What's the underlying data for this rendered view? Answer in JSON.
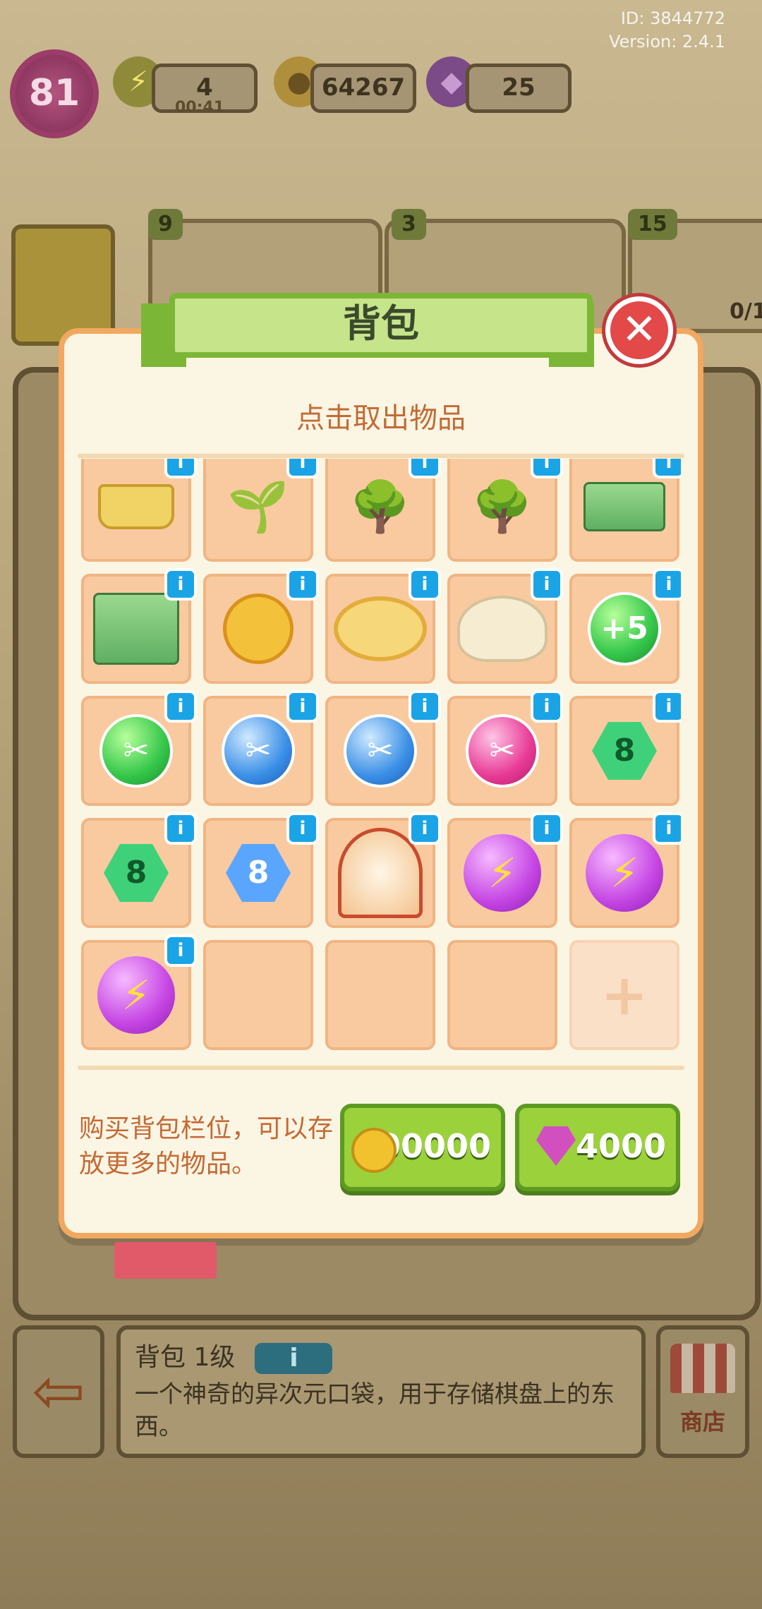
{
  "header": {
    "id_text": "ID: 3844772",
    "version_text": "Version: 2.4.1",
    "level": "81",
    "energy": "4",
    "energy_timer": "00:41",
    "coins": "64267",
    "gems": "25"
  },
  "background": {
    "star_badges": [
      "9",
      "3",
      "15"
    ],
    "trophy_text": "0/1"
  },
  "modal": {
    "title": "背包",
    "subtitle": "点击取出物品",
    "close_icon": "close-icon",
    "items": [
      {
        "kind": "basket",
        "name": "basket-item"
      },
      {
        "kind": "sprout",
        "name": "sprout-pot-item"
      },
      {
        "kind": "tree",
        "name": "flower-tree-item"
      },
      {
        "kind": "tree",
        "name": "flower-tree-item"
      },
      {
        "kind": "cash",
        "name": "cash-bundle-item"
      },
      {
        "kind": "cash-big",
        "name": "cash-pile-item"
      },
      {
        "kind": "medal",
        "name": "medal-item"
      },
      {
        "kind": "ring",
        "name": "duck-float-item"
      },
      {
        "kind": "duck",
        "name": "duck-plush-item"
      },
      {
        "kind": "orb-green",
        "name": "plus5-orb-item",
        "label": "+5"
      },
      {
        "kind": "orb-green",
        "name": "scissors-green-orb-item",
        "label": "✂"
      },
      {
        "kind": "orb-blue",
        "name": "scissors-blue-orb-item",
        "label": "✂"
      },
      {
        "kind": "orb-blue",
        "name": "scissors-blue-orb-item",
        "label": "✂"
      },
      {
        "kind": "orb-pink",
        "name": "scissors-pink-orb-item",
        "label": "✂"
      },
      {
        "kind": "hex-green",
        "name": "hourglass-green-item",
        "label": "8"
      },
      {
        "kind": "hex-green",
        "name": "hourglass-green-item",
        "label": "8"
      },
      {
        "kind": "hex-blue",
        "name": "hourglass-blue-item",
        "label": "8"
      },
      {
        "kind": "globe",
        "name": "plasma-globe-item"
      },
      {
        "kind": "orb-purple",
        "name": "energy-orb-item",
        "label": "⚡"
      },
      {
        "kind": "orb-purple",
        "name": "energy-orb-item",
        "label": "⚡"
      },
      {
        "kind": "orb-purple",
        "name": "energy-orb-item",
        "label": "⚡"
      },
      {
        "kind": "empty"
      },
      {
        "kind": "empty"
      },
      {
        "kind": "empty"
      },
      {
        "kind": "add"
      }
    ],
    "buy_text": "购买背包栏位，可以存放更多的物品。",
    "buy_coins_label": "100000",
    "buy_gems_label": "4000"
  },
  "bottom": {
    "item_title": "背包 1级",
    "item_desc": "一个神奇的异次元口袋，用于存储棋盘上的东西。",
    "shop_label": "商店"
  },
  "colors": {
    "accent_orange": "#f1a860",
    "button_green": "#9bd13b",
    "info_blue": "#1aa4e6",
    "close_red": "#e24948"
  }
}
